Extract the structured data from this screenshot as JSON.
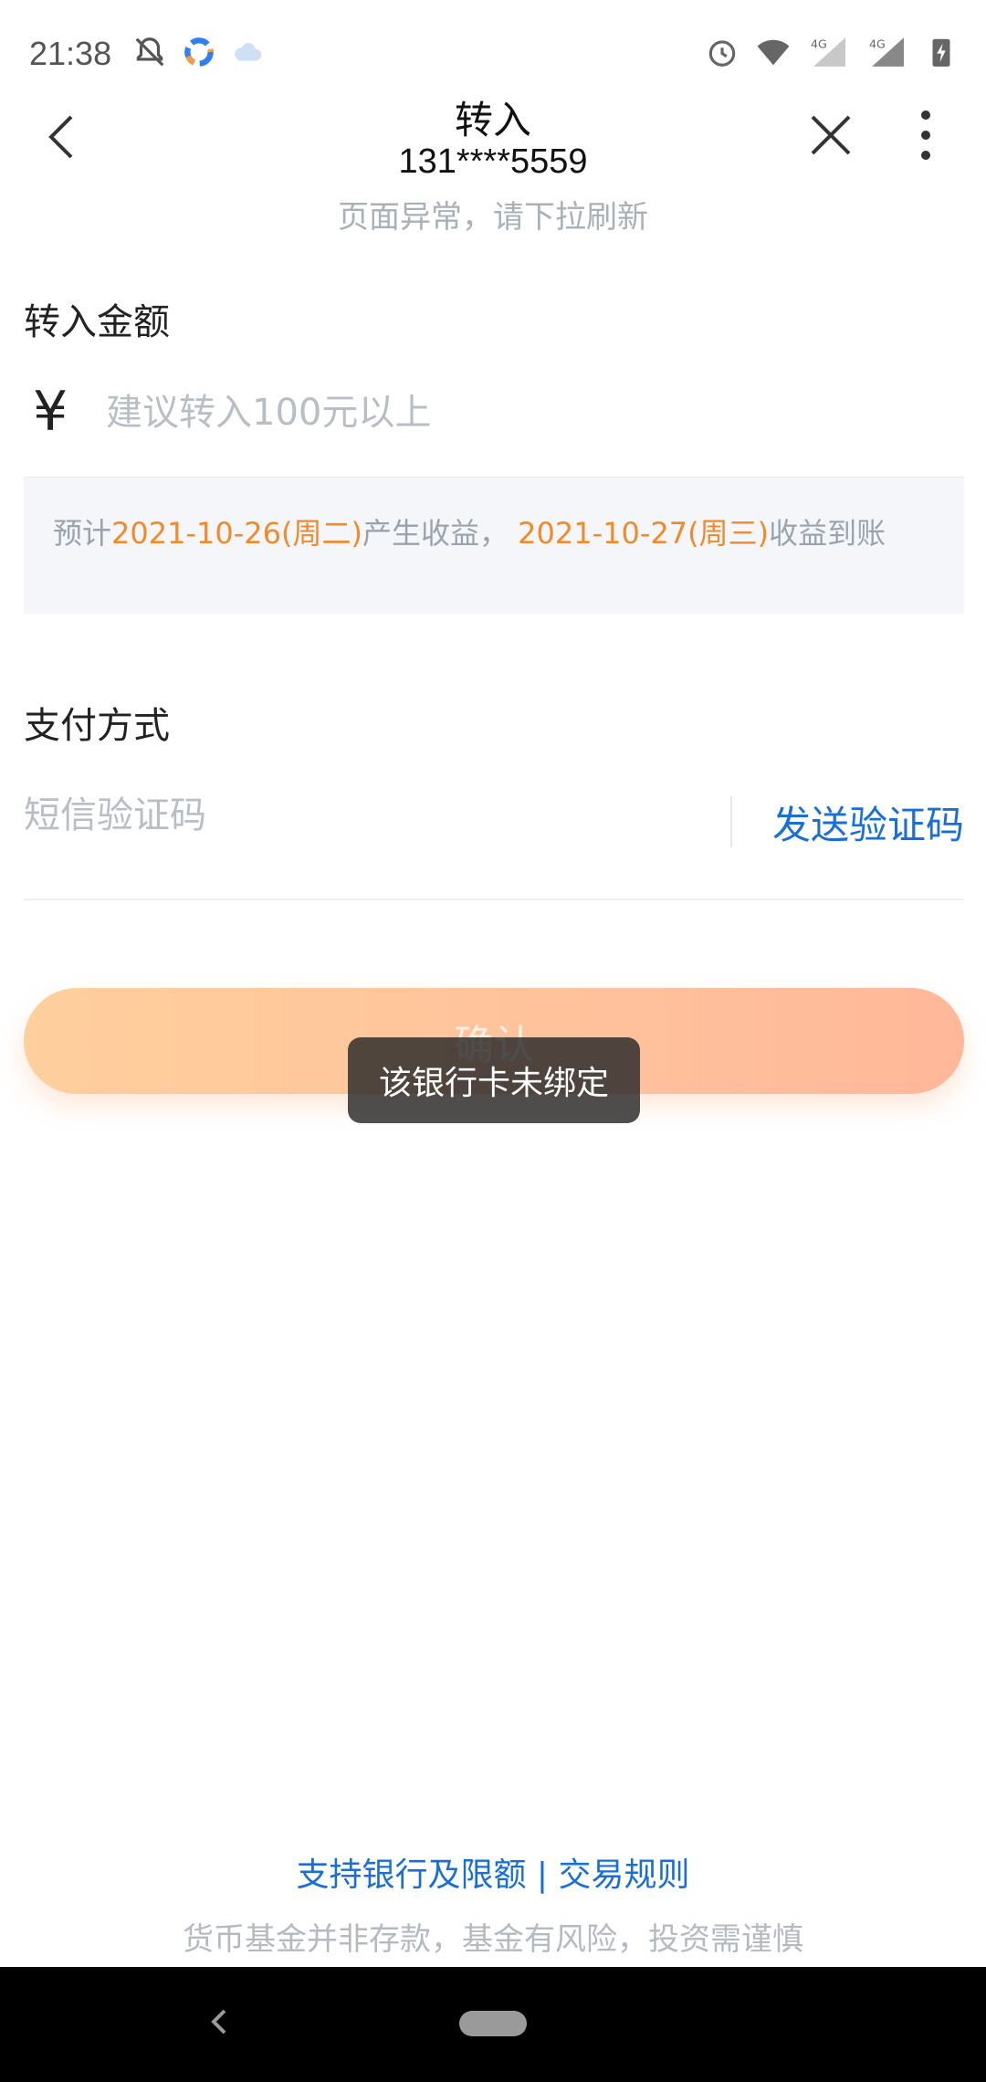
{
  "status_bar": {
    "time": "21:38",
    "left_icons": [
      "bell-off-icon",
      "app-ring-icon",
      "cloud-icon"
    ],
    "right_icons": [
      "alarm-icon",
      "wifi-icon",
      "signal-4g-icon",
      "signal-4g-icon",
      "battery-charging-icon"
    ]
  },
  "header": {
    "title": "转入",
    "account": "131****5559",
    "notice": "页面异常，请下拉刷新"
  },
  "amount": {
    "label": "转入金额",
    "currency_symbol": "¥",
    "placeholder": "建议转入100元以上"
  },
  "estimate": {
    "prefix": "预计",
    "income_date": "2021-10-26(周二)",
    "middle": "产生收益，",
    "arrival_date": "2021-10-27(周三)",
    "suffix": "收益到账",
    "highlight_color": "#f08a2a"
  },
  "payment": {
    "label": "支付方式",
    "sms_placeholder": "短信验证码",
    "send_code_label": "发送验证码"
  },
  "confirm": {
    "label": "确认"
  },
  "toast": {
    "message": "该银行卡未绑定"
  },
  "footer": {
    "banks_link": "支持银行及限额",
    "separator": "|",
    "rules_link": "交易规则",
    "disclaimer": "货币基金并非存款，基金有风险，投资需谨慎"
  },
  "colors": {
    "link_blue": "#1a6fd6",
    "button_gradient_start": "#ffcf9d",
    "button_gradient_end": "#ffb89a"
  }
}
